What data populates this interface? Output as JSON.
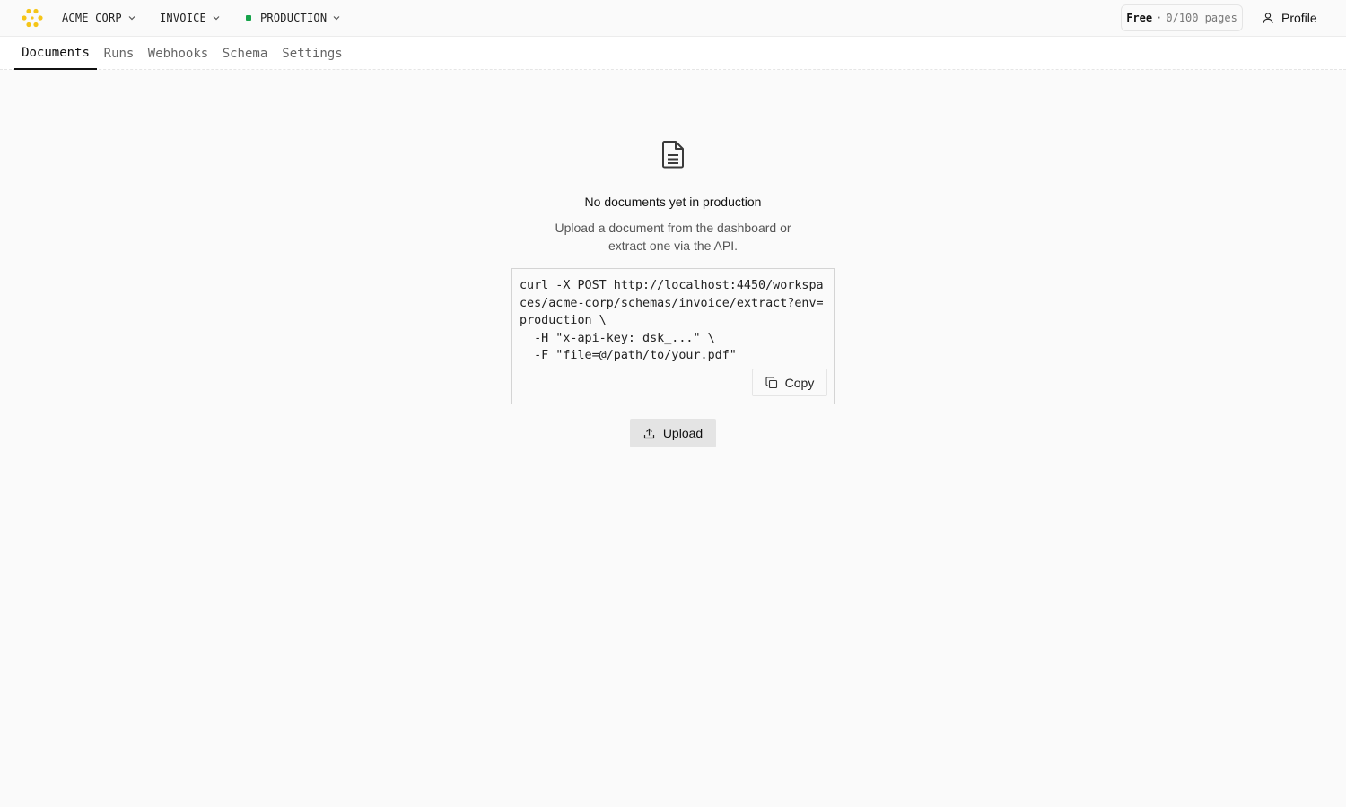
{
  "header": {
    "workspace": "ACME CORP",
    "schema": "INVOICE",
    "environment": "PRODUCTION",
    "environment_color": "#16a34a",
    "logo_color": "#f5c518",
    "plan": {
      "name": "Free",
      "separator": "·",
      "usage": "0/100 pages"
    },
    "profile_label": "Profile"
  },
  "tabs": [
    {
      "label": "Documents",
      "active": true
    },
    {
      "label": "Runs",
      "active": false
    },
    {
      "label": "Webhooks",
      "active": false
    },
    {
      "label": "Schema",
      "active": false
    },
    {
      "label": "Settings",
      "active": false
    }
  ],
  "empty_state": {
    "icon": "document-icon",
    "title": "No documents yet in production",
    "description": "Upload a document from the dashboard or extract one via the API.",
    "code": "curl -X POST http://localhost:4450/workspaces/acme-corp/schemas/invoice/extract?env=production \\\n  -H \"x-api-key: dsk_...\" \\\n  -F \"file=@/path/to/your.pdf\"",
    "copy_label": "Copy",
    "upload_label": "Upload"
  }
}
